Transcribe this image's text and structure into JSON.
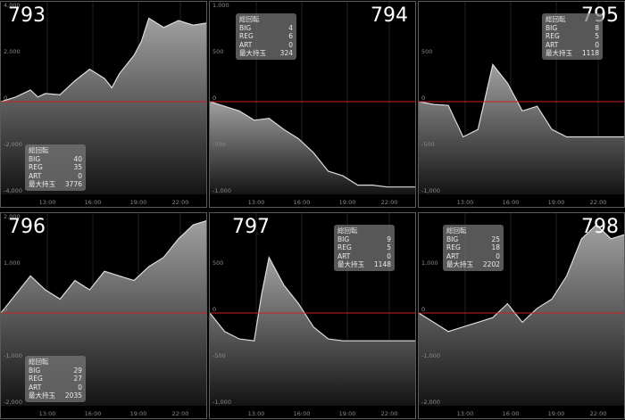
{
  "colors": {
    "zero_line": "#cc2222",
    "fill_top": "#a0a0a0",
    "fill_bottom": "#141414",
    "line": "#dcdcdc",
    "grid": "#3a3a3a",
    "panel_border": "#5a5a5a"
  },
  "x_tick_labels": [
    "13:00",
    "16:00",
    "19:00",
    "22:00"
  ],
  "stat_labels": {
    "total": "総回転",
    "big": "BIG",
    "reg": "REG",
    "art": "ART",
    "max": "最大持玉"
  },
  "panels": [
    {
      "machine": "793",
      "stats": {
        "big": "40",
        "reg": "35",
        "art": "0",
        "max": "3776"
      },
      "y_ticks": [
        {
          "v": 4000,
          "label": "4,000"
        },
        {
          "v": 2000,
          "label": "2,000"
        },
        {
          "v": 0,
          "label": "0"
        },
        {
          "v": -2000,
          "label": "-2,000"
        },
        {
          "v": -4000,
          "label": "-4,000"
        }
      ],
      "chart_data": {
        "type": "area",
        "ylim": [
          -4000,
          4000
        ],
        "xlim": [
          10,
          24
        ],
        "x": [
          10,
          11,
          12,
          12.5,
          13,
          14,
          15,
          16,
          17,
          17.5,
          18,
          19,
          19.5,
          20,
          21,
          22,
          23,
          24
        ],
        "y": [
          0,
          200,
          500,
          200,
          350,
          300,
          900,
          1400,
          1000,
          600,
          1200,
          2000,
          2600,
          3600,
          3200,
          3500,
          3300,
          3400
        ]
      }
    },
    {
      "machine": "794",
      "stats": {
        "big": "4",
        "reg": "6",
        "art": "0",
        "max": "324"
      },
      "y_ticks": [
        {
          "v": 1000,
          "label": "1,000"
        },
        {
          "v": 500,
          "label": "500"
        },
        {
          "v": 0,
          "label": "0"
        },
        {
          "v": -500,
          "label": "-500"
        },
        {
          "v": -1000,
          "label": "-1,000"
        }
      ],
      "chart_data": {
        "type": "area",
        "ylim": [
          -1000,
          1000
        ],
        "xlim": [
          10,
          24
        ],
        "x": [
          10,
          11,
          12,
          13,
          14,
          15,
          16,
          17,
          18,
          19,
          20,
          21,
          22,
          23,
          24
        ],
        "y": [
          0,
          -50,
          -100,
          -200,
          -180,
          -300,
          -400,
          -550,
          -750,
          -800,
          -900,
          -900,
          -920,
          -920,
          -920
        ]
      }
    },
    {
      "machine": "795",
      "stats": {
        "big": "8",
        "reg": "5",
        "art": "0",
        "max": "1118"
      },
      "y_ticks": [
        {
          "v": 500,
          "label": "500"
        },
        {
          "v": 0,
          "label": "0"
        },
        {
          "v": -500,
          "label": "-500"
        },
        {
          "v": -1000,
          "label": "-1,000"
        }
      ],
      "chart_data": {
        "type": "area",
        "ylim": [
          -1000,
          1000
        ],
        "xlim": [
          10,
          24
        ],
        "x": [
          10,
          11,
          12,
          13,
          14,
          15,
          16,
          17,
          18,
          19,
          20,
          21,
          22,
          23,
          24
        ],
        "y": [
          0,
          -30,
          -40,
          -380,
          -300,
          400,
          200,
          -100,
          -50,
          -300,
          -380,
          -380,
          -380,
          -380,
          -380
        ]
      }
    },
    {
      "machine": "796",
      "stats": {
        "big": "29",
        "reg": "27",
        "art": "0",
        "max": "2035"
      },
      "y_ticks": [
        {
          "v": 2000,
          "label": "2,000"
        },
        {
          "v": 1000,
          "label": "1,000"
        },
        {
          "v": 0,
          "label": "0"
        },
        {
          "v": -1000,
          "label": "-1,000"
        },
        {
          "v": -2000,
          "label": "-2,000"
        }
      ],
      "chart_data": {
        "type": "area",
        "ylim": [
          -2000,
          2000
        ],
        "xlim": [
          10,
          24
        ],
        "x": [
          10,
          11,
          12,
          13,
          14,
          15,
          16,
          17,
          18,
          19,
          20,
          21,
          22,
          23,
          24
        ],
        "y": [
          0,
          400,
          800,
          500,
          300,
          700,
          500,
          900,
          800,
          700,
          1000,
          1200,
          1600,
          1900,
          2000
        ]
      }
    },
    {
      "machine": "797",
      "stats": {
        "big": "9",
        "reg": "5",
        "art": "0",
        "max": "1148"
      },
      "y_ticks": [
        {
          "v": 500,
          "label": "500"
        },
        {
          "v": 0,
          "label": "0"
        },
        {
          "v": -500,
          "label": "-500"
        },
        {
          "v": -1000,
          "label": "-1,000"
        }
      ],
      "chart_data": {
        "type": "area",
        "ylim": [
          -1000,
          1000
        ],
        "xlim": [
          10,
          24
        ],
        "x": [
          10,
          11,
          12,
          13,
          13.5,
          14,
          15,
          16,
          17,
          18,
          19,
          20,
          21,
          22,
          23,
          24
        ],
        "y": [
          0,
          -200,
          -280,
          -300,
          200,
          600,
          300,
          100,
          -150,
          -280,
          -300,
          -300,
          -300,
          -300,
          -300,
          -300
        ]
      }
    },
    {
      "machine": "798",
      "stats": {
        "big": "25",
        "reg": "18",
        "art": "0",
        "max": "2202"
      },
      "y_ticks": [
        {
          "v": 1000,
          "label": "1,000"
        },
        {
          "v": 0,
          "label": "0"
        },
        {
          "v": -1000,
          "label": "-1,000"
        },
        {
          "v": -2000,
          "label": "-2,000"
        }
      ],
      "chart_data": {
        "type": "area",
        "ylim": [
          -2000,
          2000
        ],
        "xlim": [
          10,
          24
        ],
        "x": [
          10,
          11,
          12,
          13,
          14,
          15,
          16,
          17,
          18,
          19,
          20,
          21,
          22,
          23,
          24
        ],
        "y": [
          0,
          -200,
          -400,
          -300,
          -200,
          -100,
          200,
          -200,
          100,
          300,
          800,
          1600,
          1900,
          1600,
          1700
        ]
      }
    }
  ]
}
